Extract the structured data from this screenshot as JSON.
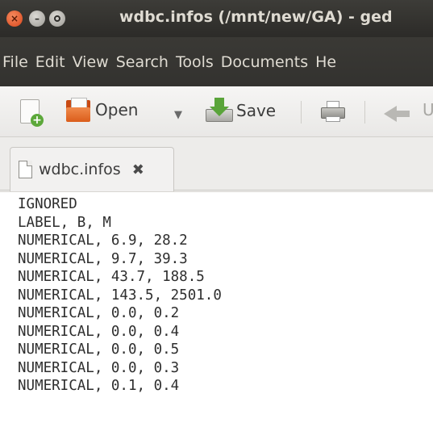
{
  "window": {
    "title": "wdbc.infos (/mnt/new/GA) - ged"
  },
  "menubar": {
    "items": [
      "File",
      "Edit",
      "View",
      "Search",
      "Tools",
      "Documents",
      "He"
    ]
  },
  "toolbar": {
    "open_label": "Open",
    "save_label": "Save",
    "undo_label": "U"
  },
  "tab": {
    "label": "wdbc.infos"
  },
  "editor": {
    "lines": [
      "IGNORED",
      "LABEL, B, M",
      "NUMERICAL, 6.9, 28.2",
      "NUMERICAL, 9.7, 39.3",
      "NUMERICAL, 43.7, 188.5",
      "NUMERICAL, 143.5, 2501.0",
      "NUMERICAL, 0.0, 0.2",
      "NUMERICAL, 0.0, 0.4",
      "NUMERICAL, 0.0, 0.5",
      "NUMERICAL, 0.0, 0.3",
      "NUMERICAL, 0.1, 0.4"
    ]
  }
}
